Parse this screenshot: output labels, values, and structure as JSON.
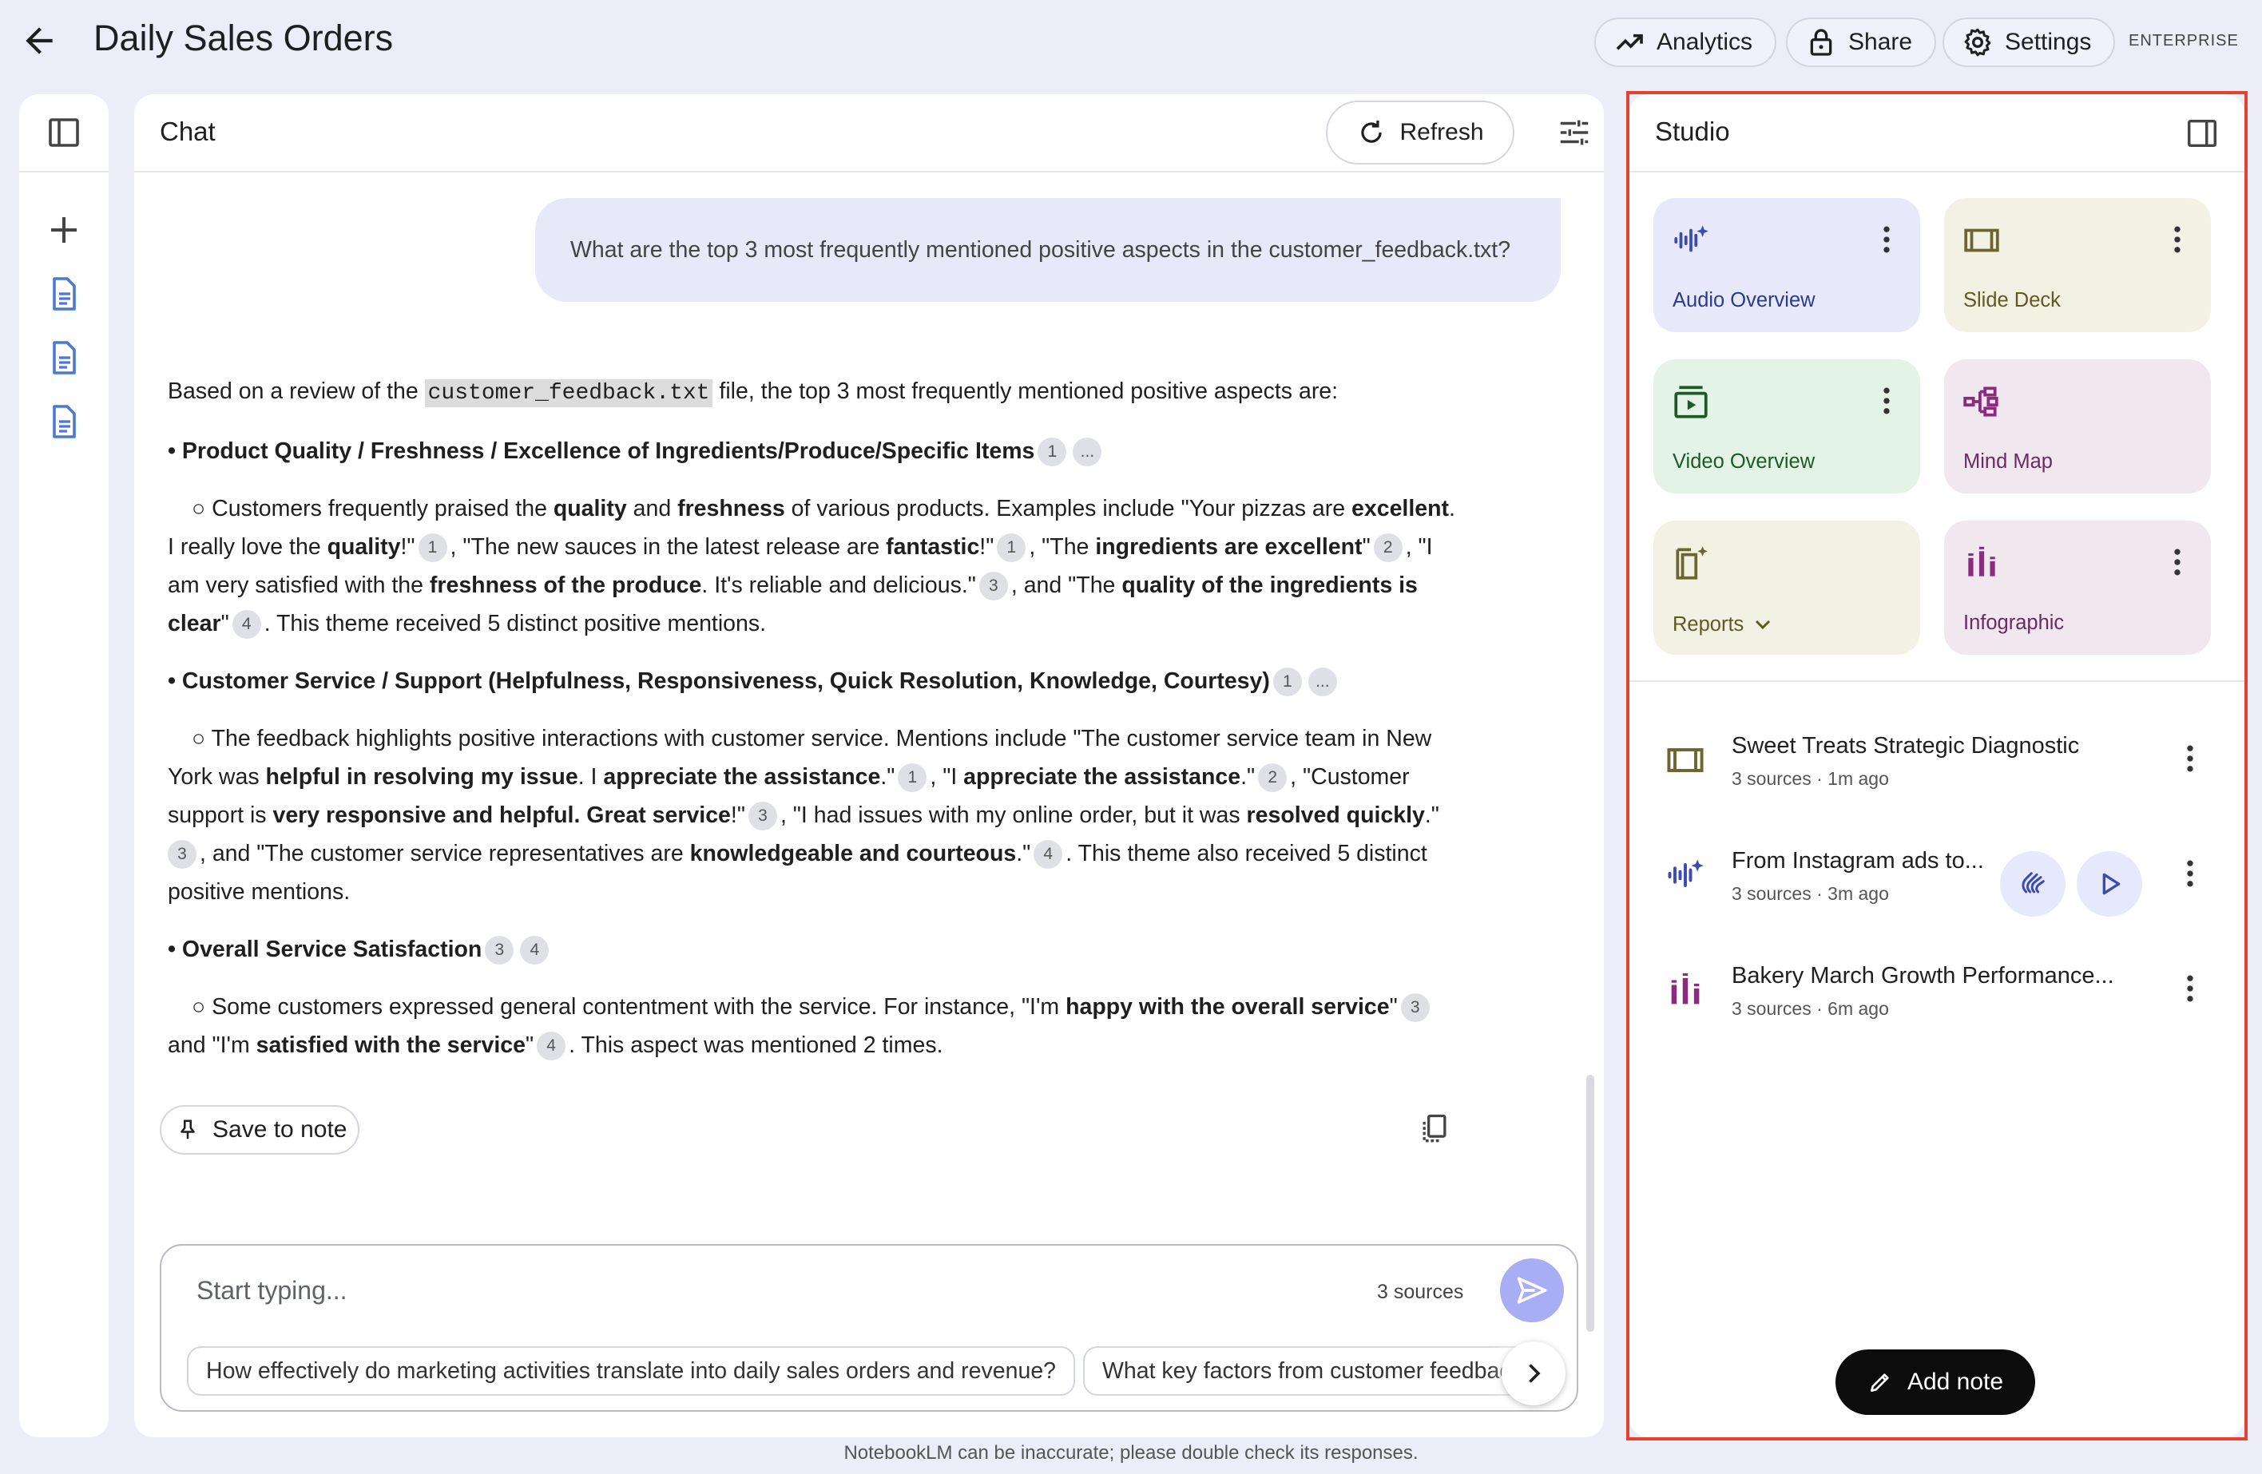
{
  "app": {
    "title": "Daily Sales Orders",
    "badge": "ENTERPRISE",
    "footer": "NotebookLM can be inaccurate; please double check its responses."
  },
  "topbar": {
    "analytics": "Analytics",
    "share": "Share",
    "settings": "Settings"
  },
  "chat": {
    "header": "Chat",
    "refresh": "Refresh",
    "user_message": "What are the top 3 most frequently mentioned positive aspects in the customer_feedback.txt?",
    "response": {
      "intro_a": "Based on a review of the ",
      "intro_code": "customer_feedback.txt",
      "intro_b": " file, the top 3 most frequently mentioned positive aspects are:",
      "s1": {
        "heading": "• Product Quality / Freshness / Excellence of Ingredients/Produce/Specific Items",
        "l1_a": "○ Customers frequently praised the ",
        "l1_b": "quality",
        "l1_c": " and ",
        "l1_d": "freshness",
        "l1_e": " of various products. Examples include \"Your pizzas are ",
        "l1_f": "excellent",
        "l1_g": ".",
        "l2_a": "I really love the ",
        "l2_b": "quality",
        "l2_c": "!\"",
        "l2_d": ", \"The new sauces in the latest release are ",
        "l2_e": "fantastic",
        "l2_f": "!\"",
        "l2_g": ", \"The ",
        "l2_h": "ingredients are excellent",
        "l2_i": "\"",
        "l2_j": ", \"I",
        "l3_a": "am very satisfied with the ",
        "l3_b": "freshness of the produce",
        "l3_c": ". It's reliable and delicious.\"",
        "l3_d": ", and \"The ",
        "l3_e": "quality of the ingredients is",
        "l4_a": "clear",
        "l4_b": "\"",
        "l4_c": ". This theme received 5 distinct positive mentions."
      },
      "s2": {
        "heading": "• Customer Service / Support (Helpfulness, Responsiveness, Quick Resolution, Knowledge, Courtesy)",
        "l1_a": "○ The feedback highlights positive interactions with customer service. Mentions include \"The customer service team in New",
        "l2_a": "York was ",
        "l2_b": "helpful in resolving my issue",
        "l2_c": ". I ",
        "l2_d": "appreciate the assistance",
        "l2_e": ".\"",
        "l2_f": ", \"I ",
        "l2_g": "appreciate the assistance",
        "l2_h": ".\"",
        "l2_i": ", \"Customer",
        "l3_a": "support is ",
        "l3_b": "very responsive and helpful. Great service",
        "l3_c": "!\"",
        "l3_d": ", \"I had issues with my online order, but it was ",
        "l3_e": "resolved quickly",
        "l3_f": ".\"",
        "l4_a": ", and \"The customer service representatives are ",
        "l4_b": "knowledgeable and courteous",
        "l4_c": ".\"",
        "l4_d": ". This theme also received 5 distinct",
        "l5_a": "positive mentions."
      },
      "s3": {
        "heading": "• Overall Service Satisfaction",
        "l1_a": "○ Some customers expressed general contentment with the service. For instance, \"I'm ",
        "l1_b": "happy with the overall service",
        "l1_c": "\"",
        "l2_a": "and \"I'm ",
        "l2_b": "satisfied with the service",
        "l2_c": "\"",
        "l2_d": ". This aspect was mentioned 2 times."
      },
      "cite": {
        "c1": "1",
        "c2": "2",
        "c3": "3",
        "c4": "4",
        "more": "..."
      }
    },
    "save_note": "Save to note",
    "input": {
      "placeholder": "Start typing...",
      "sources": "3 sources"
    },
    "suggestions": [
      "How effectively do marketing activities translate into daily sales orders and revenue?",
      "What key factors from customer feedback"
    ]
  },
  "studio": {
    "header": "Studio",
    "cards": [
      {
        "label": "Audio Overview",
        "color": "#e7e9fb",
        "text_color": "#2b3a8f"
      },
      {
        "label": "Slide Deck",
        "color": "#f2f1e4",
        "text_color": "#5f5a22"
      },
      {
        "label": "Video Overview",
        "color": "#e3f3e5",
        "text_color": "#1d5a2a"
      },
      {
        "label": "Mind Map",
        "color": "#f1e7ee",
        "text_color": "#6b2a63"
      },
      {
        "label": "Reports",
        "color": "#f2f1e4",
        "text_color": "#5f5a22"
      },
      {
        "label": "Infographic",
        "color": "#f1e7ee",
        "text_color": "#6b2a63"
      }
    ],
    "notes": [
      {
        "title": "Sweet Treats Strategic Diagnostic",
        "meta": "3 sources · 1m ago",
        "icon": "slide-deck-icon"
      },
      {
        "title": "From Instagram ads to...",
        "meta": "3 sources · 3m ago",
        "icon": "audio-overview-icon"
      },
      {
        "title": "Bakery March Growth Performance...",
        "meta": "3 sources · 6m ago",
        "icon": "infographic-icon"
      }
    ],
    "add_note": "Add note"
  }
}
